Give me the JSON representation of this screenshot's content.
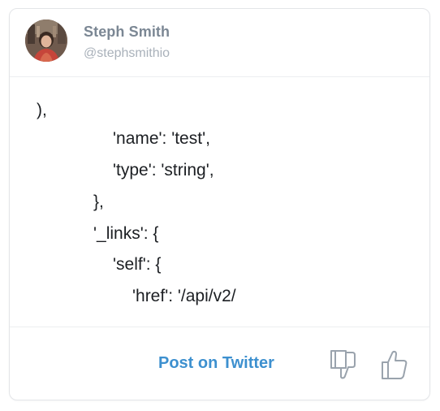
{
  "card": {
    "author": {
      "name": "Steph Smith",
      "handle": "@stephsmithio"
    },
    "content_lines": [
      "),",
      "'name': 'test',",
      "'type': 'string',",
      "},",
      "'_links': {",
      "'self': {",
      "'href': '/api/v2/"
    ],
    "footer": {
      "post_label": "Post on Twitter",
      "thumbs_down_icon": "thumbs-down-icon",
      "thumbs_up_icon": "thumbs-up-icon"
    }
  },
  "colors": {
    "link": "#3d90cf",
    "name": "#7b8794",
    "handle": "#a9b1ba",
    "text": "#1c1f23",
    "icon": "#9aa3ad"
  }
}
